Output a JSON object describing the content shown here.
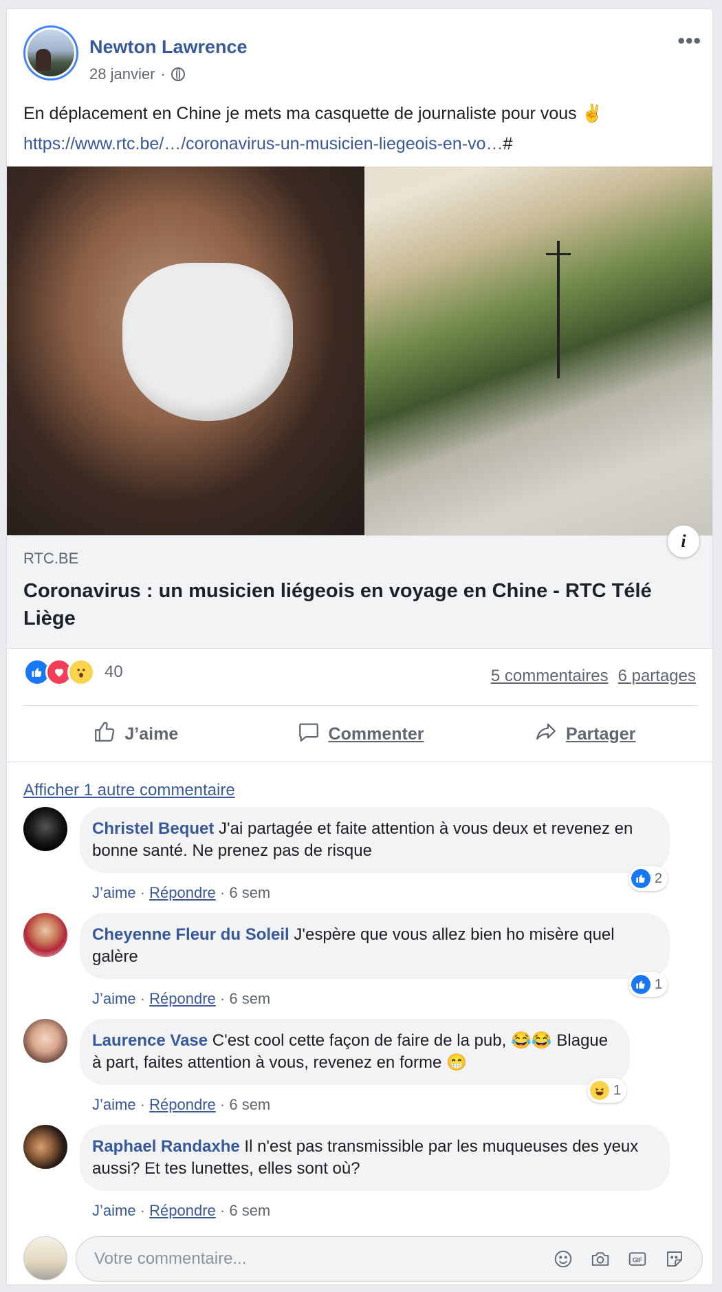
{
  "post": {
    "author": "Newton Lawrence",
    "date": "28 janvier",
    "separator": "·",
    "menu": "•••",
    "text": "En déplacement en Chine je mets ma casquette de journaliste pour vous ✌️",
    "link": "https://www.rtc.be/…/coronavirus-un-musicien-liegeois-en-vo…",
    "link_suffix": "#"
  },
  "link_preview": {
    "info": "i",
    "domain": "RTC.BE",
    "title": "Coronavirus : un musicien liégeois en voyage en Chine - RTC Télé Liège"
  },
  "reactions": {
    "icons": [
      "like-icon",
      "love-icon",
      "wow-icon"
    ],
    "count": "40",
    "comments": "5 commentaires",
    "shares": "6 partages"
  },
  "actions": {
    "like": "J’aime",
    "comment": "Commenter",
    "share": "Partager"
  },
  "comments_section": {
    "more_comments": "Afficher 1 autre commentaire",
    "items": [
      {
        "name": "Christel Bequet",
        "text": "J'ai partagée et faite attention à vous deux et revenez en bonne santé. Ne prenez pas de risque",
        "like": "J’aime",
        "reply": "Répondre",
        "time": "6 sem",
        "reaction": "like",
        "reaction_count": "2"
      },
      {
        "name": "Cheyenne Fleur du Soleil",
        "text": "J'espère que vous allez bien ho misère quel galère",
        "like": "J’aime",
        "reply": "Répondre",
        "time": "6 sem",
        "reaction": "like",
        "reaction_count": "1"
      },
      {
        "name": "Laurence Vase",
        "text": "C'est cool cette façon de faire de la pub, 😂😂 Blague à part, faites attention à vous, revenez en forme 😁",
        "like": "J’aime",
        "reply": "Répondre",
        "time": "6 sem",
        "reaction": "haha",
        "reaction_count": "1"
      },
      {
        "name": "Raphael Randaxhe",
        "text": "Il n'est pas transmissible par les muqueuses des yeux aussi? Et tes lunettes, elles sont où?",
        "like": "J’aime",
        "reply": "Répondre",
        "time": "6 sem"
      }
    ]
  },
  "composer": {
    "placeholder": "Votre commentaire...",
    "icons": [
      "emoji-icon",
      "camera-icon",
      "gif-icon",
      "sticker-icon"
    ]
  },
  "colors": {
    "link": "#385898",
    "like": "#1877f2",
    "love": "#f33e58",
    "muted": "#606770",
    "bubble": "#f2f3f5"
  }
}
